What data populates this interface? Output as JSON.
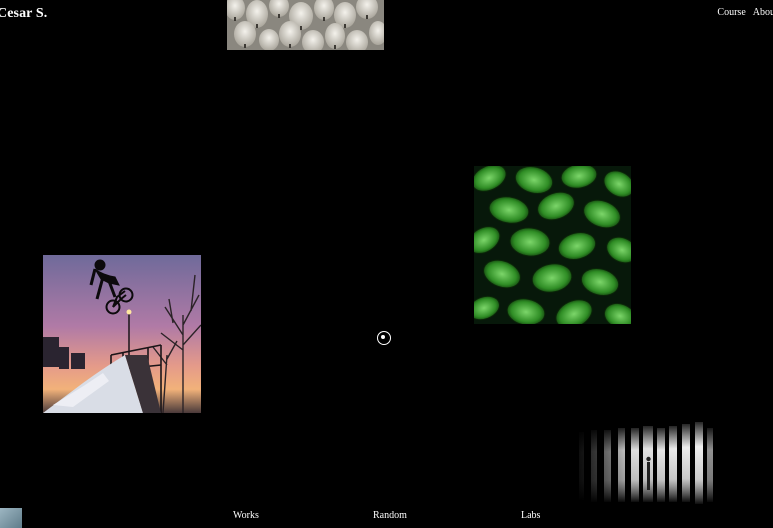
{
  "header": {
    "brand": "Cesar S.",
    "nav": {
      "course": "Course",
      "about": "Abou"
    }
  },
  "footer": {
    "nav": {
      "works": "Works",
      "random": "Random",
      "labs": "Labs"
    }
  },
  "gallery": {
    "tiles": [
      {
        "name": "lanterns"
      },
      {
        "name": "leaves"
      },
      {
        "name": "bmx"
      },
      {
        "name": "light-bars"
      },
      {
        "name": "corner"
      }
    ]
  }
}
